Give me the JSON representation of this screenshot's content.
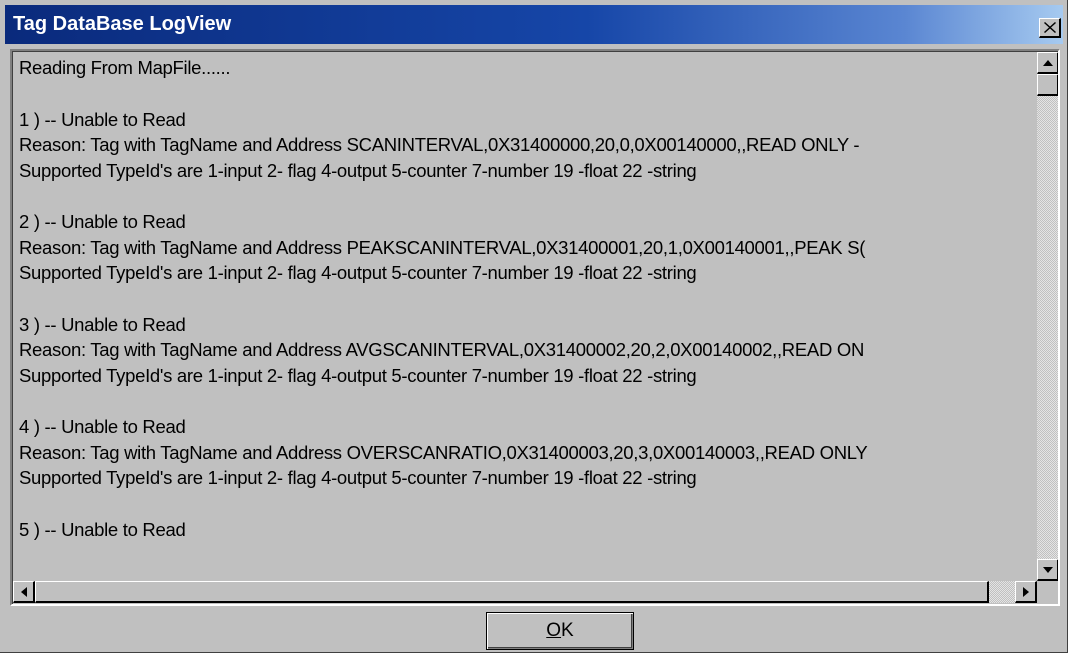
{
  "window": {
    "title": "Tag DataBase LogView",
    "close_symbol": "×"
  },
  "log": {
    "lines": [
      "Reading From MapFile......",
      "",
      "1 )  -- Unable to Read",
      "Reason: Tag with TagName and Address SCANINTERVAL,0X31400000,20,0,0X00140000,,READ ONLY -",
      "Supported TypeId's are 1-input  2- flag 4-output  5-counter  7-number  19 -float  22 -string",
      "",
      "2 )  -- Unable to Read",
      "Reason: Tag with TagName and Address PEAKSCANINTERVAL,0X31400001,20,1,0X00140001,,PEAK S(",
      "Supported TypeId's are 1-input  2- flag 4-output  5-counter  7-number  19 -float  22 -string",
      "",
      "3 )  -- Unable to Read",
      "Reason: Tag with TagName and Address AVGSCANINTERVAL,0X31400002,20,2,0X00140002,,READ ON",
      "Supported TypeId's are 1-input  2- flag 4-output  5-counter  7-number  19 -float  22 -string",
      "",
      "4 )  -- Unable to Read",
      "Reason: Tag with TagName and Address OVERSCANRATIO,0X31400003,20,3,0X00140003,,READ ONLY",
      "Supported TypeId's are 1-input  2- flag 4-output  5-counter  7-number  19 -float  22 -string",
      "",
      "5 )  -- Unable to Read"
    ]
  },
  "scrollbars": {
    "vertical": {
      "up_icon": "arrow-up-icon",
      "down_icon": "arrow-down-icon"
    },
    "horizontal": {
      "left_icon": "arrow-left-icon",
      "right_icon": "arrow-right-icon"
    }
  },
  "buttons": {
    "ok_mnemonic": "O",
    "ok_rest": "K"
  },
  "colors": {
    "face": "#c0c0c0",
    "titlebar_start": "#0a2a7c",
    "titlebar_end": "#a6caf0",
    "title_text": "#ffffff"
  }
}
